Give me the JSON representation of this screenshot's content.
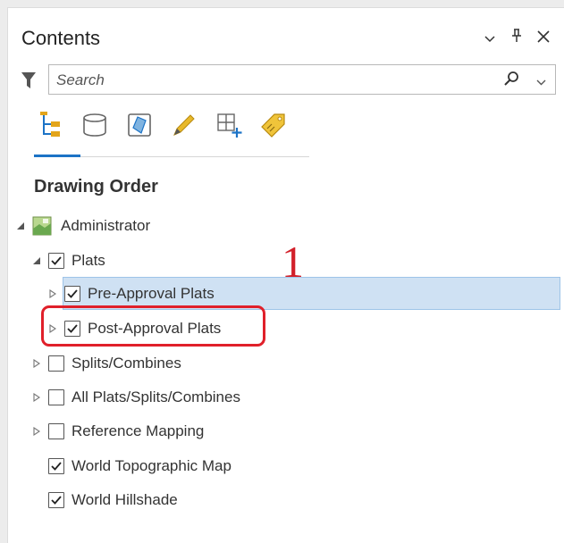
{
  "pane": {
    "title": "Contents",
    "actions": [
      "chevron-down",
      "pin",
      "close"
    ]
  },
  "search": {
    "placeholder": "Search"
  },
  "toolbar": {
    "tools": [
      "list-by-drawing-order-icon",
      "list-by-data-source-icon",
      "list-by-selection-icon",
      "list-by-editing-icon",
      "list-by-snapping-icon",
      "list-by-labeling-icon"
    ]
  },
  "section": {
    "title": "Drawing Order"
  },
  "layers": {
    "map": {
      "label": "Administrator"
    },
    "plats": {
      "label": "Plats",
      "checked": true
    },
    "pre_approval": {
      "label": "Pre-Approval Plats",
      "checked": true
    },
    "post_approval": {
      "label": "Post-Approval Plats",
      "checked": true
    },
    "splits": {
      "label": "Splits/Combines",
      "checked": false
    },
    "all": {
      "label": "All Plats/Splits/Combines",
      "checked": false
    },
    "reference": {
      "label": "Reference Mapping",
      "checked": false
    },
    "topo": {
      "label": "World Topographic Map",
      "checked": true
    },
    "hillshade": {
      "label": "World Hillshade",
      "checked": true
    }
  },
  "annotation": {
    "step": "1"
  },
  "colors": {
    "accent": "#1c73c6",
    "selection": "#cfe1f3",
    "callout": "#e0202a"
  }
}
